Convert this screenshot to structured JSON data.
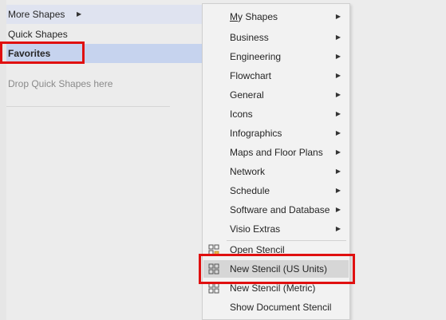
{
  "shapes_pane": {
    "more_shapes": "More Shapes",
    "quick_shapes": "Quick Shapes",
    "favorites": "Favorites",
    "drop_hint": "Drop Quick Shapes here"
  },
  "menu": {
    "my_shapes": {
      "prefix": "",
      "underline": "M",
      "rest": "y Shapes"
    },
    "submenus": [
      "Business",
      "Engineering",
      "Flowchart",
      "General",
      "Icons",
      "Infographics",
      "Maps and Floor Plans",
      "Network",
      "Schedule",
      "Software and Database",
      "Visio Extras"
    ],
    "open_stencil": "Open Stencil",
    "new_stencil_us": "New Stencil (US Units)",
    "new_stencil_metric": "New Stencil (Metric)",
    "show_document_stencil": "Show Document Stencil"
  },
  "colors": {
    "highlight_red": "#e01010",
    "selected_row": "#c6d3ee",
    "hover_item": "#d6d6d6"
  },
  "icons": {
    "submenu_arrow": "caret-right-icon",
    "open_stencil": "open-stencil-icon",
    "new_stencil": "new-stencil-grid-icon"
  }
}
